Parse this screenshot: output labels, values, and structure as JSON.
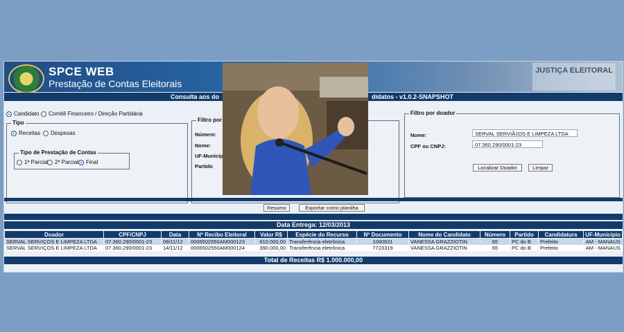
{
  "app": {
    "title": "SPCE WEB",
    "subtitle": "Prestação de Contas Eleitorais",
    "watermark": "JUSTIÇA ELEITORAL"
  },
  "consulta_bar": {
    "left_text": "Consulta aos do",
    "right_text": "didatos - v1.0.2-SNAPSHOT"
  },
  "scope": {
    "options": [
      "Candidato",
      "Comitê Financeiro / Direção Partidária"
    ],
    "selected": "Candidato"
  },
  "tipo": {
    "legend": "Tipo",
    "options": [
      "Receitas",
      "Despesas"
    ],
    "selected": "Receitas",
    "prestacao": {
      "legend": "Tipo de Prestação de Contas",
      "options": [
        "1ª Parcial",
        "2ª Parcial",
        "Final"
      ],
      "selected": "Final"
    }
  },
  "filtro_candidato": {
    "legend": "Filtro por c",
    "labels": [
      "Número:",
      "Nome:",
      "UF-Municípi",
      "Partido"
    ]
  },
  "filtro_doador": {
    "legend": "Filtro por doador",
    "nome_label": "Nome:",
    "nome_value": "SERVAL SERVIÃ‡OS E LIMPEZA LTDA",
    "cpf_label": "CPF ou CNPJ:",
    "cpf_value": "07.360.290/0001-23",
    "localizar_label": "Localizar Doador",
    "limpar_label": "Limpar"
  },
  "actions": {
    "resumo_label": "Resumo",
    "exportar_label": "Exportar como planilha"
  },
  "data_entrega": "Data Entrega: 12/03/2013",
  "table": {
    "columns": [
      "Doador",
      "CPF/CNPJ",
      "Data",
      "Nº Recibo Eleitoral",
      "Valor R$",
      "Espécie do Recurso",
      "Nº Documento",
      "Nome do Candidato",
      "Número",
      "Partido",
      "Candidatura",
      "UF-Município"
    ],
    "rows": [
      [
        "SERVAL SERVIÇOS E LIMPEZA LTDA",
        "07.360.290/0001-23",
        "09/11/12",
        "0006502550AM000123",
        "610.000,00",
        "Transferência eletrônica",
        "1060631",
        "VANESSA GRAZZIOTIN",
        "65",
        "PC do B",
        "Prefeito",
        "AM - MANAUS"
      ],
      [
        "SERVAL SERVIÇOS E LIMPEZA LTDA",
        "07.360.290/0001-23",
        "14/11/12",
        "0006502550AM000124",
        "390.000,00",
        "Transferência eletrônica",
        "7723319",
        "VANESSA GRAZZIOTIN",
        "65",
        "PC do B",
        "Prefeito",
        "AM - MANAUS"
      ]
    ]
  },
  "total_receitas": "Total de Receitas R$ 1.000.000,00",
  "colors": {
    "page_bg": "#7d9ec4",
    "navy": "#123b6c",
    "row_highlight": "#c7d6e8"
  }
}
